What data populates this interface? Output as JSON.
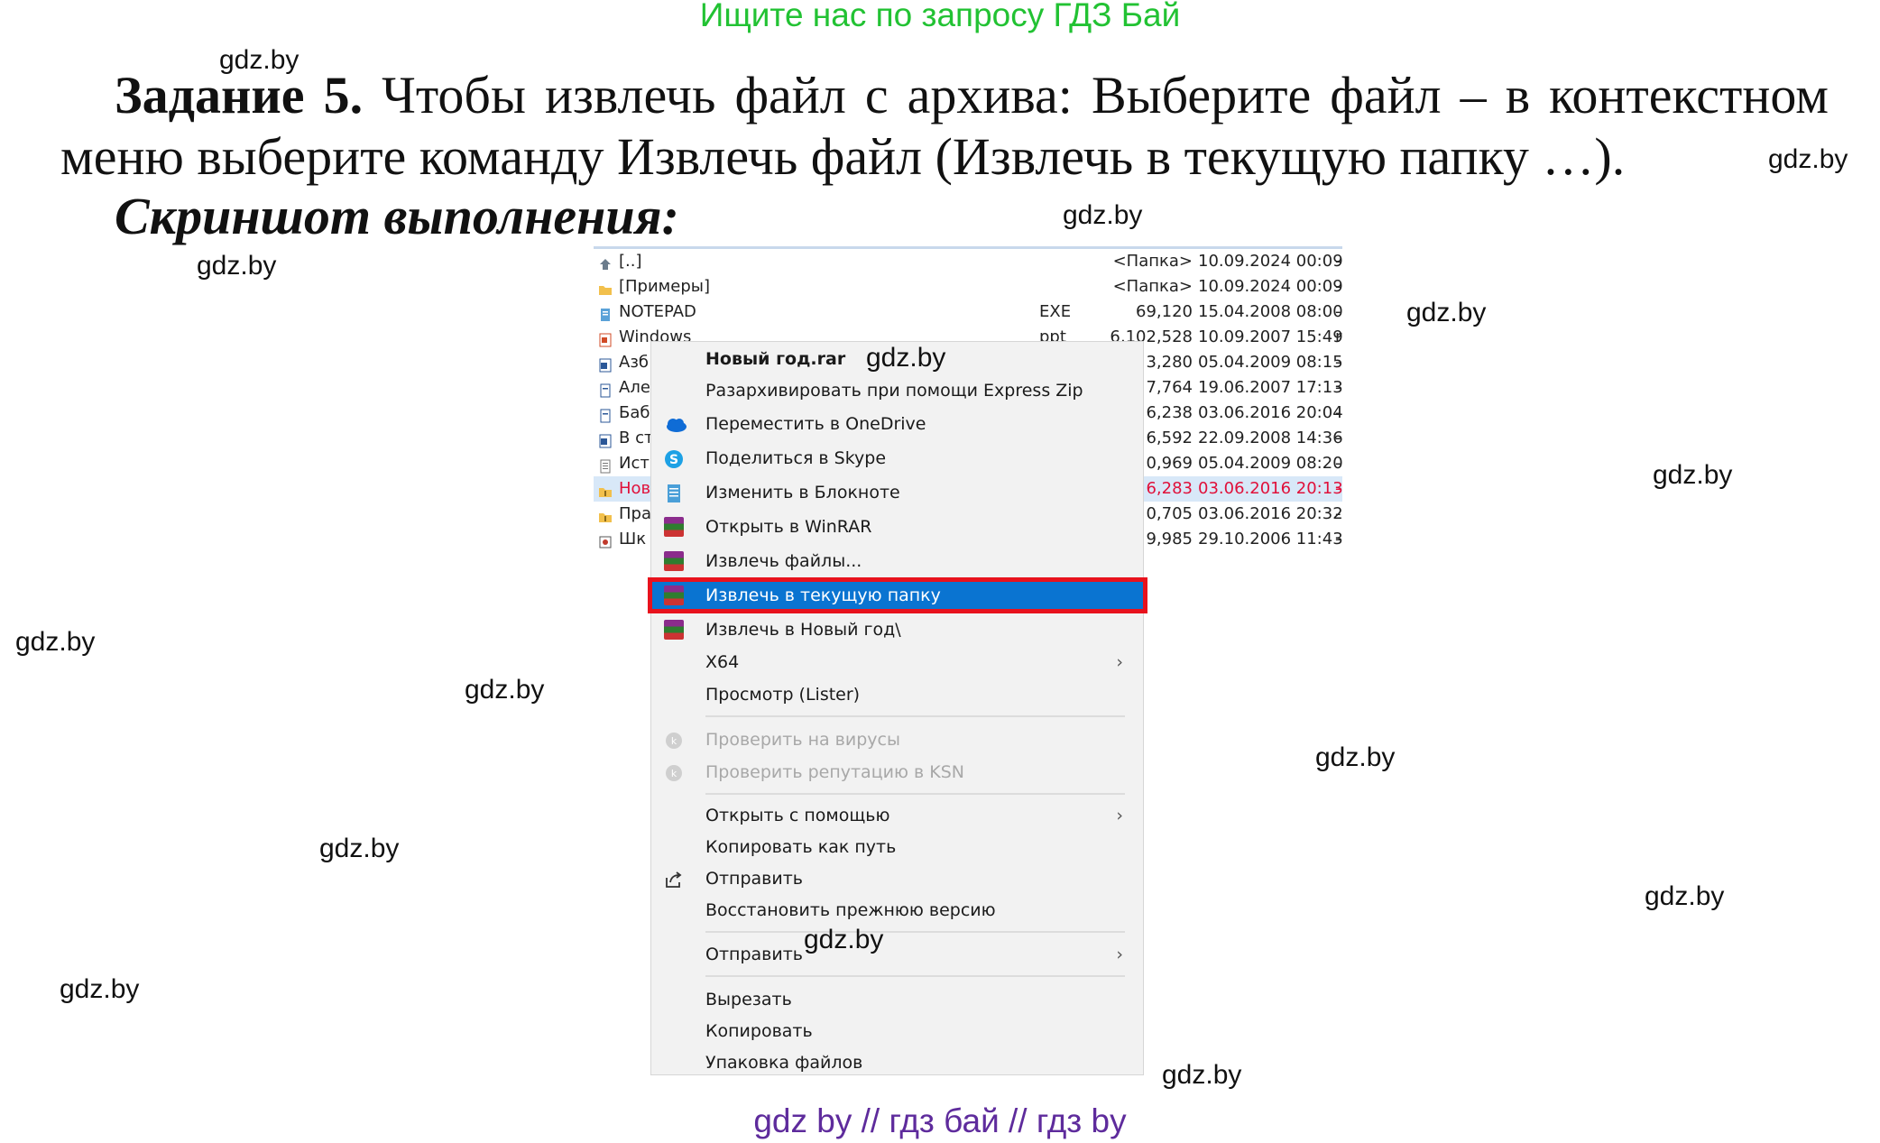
{
  "banner": "Ищите нас по запросу ГДЗ Бай",
  "task": {
    "title": "Задание 5.",
    "text1": "Чтобы извлечь файл с архива: Выберите файл – в контекстном",
    "text2": "меню выберите команду Извлечь файл (Извлечь в текущую папку …)."
  },
  "screenshot_caption": "Скриншот выполнения:",
  "watermark": "gdz.by",
  "file_list": [
    {
      "name": "[..]",
      "ext": "",
      "size": "<Папка>",
      "date": "10.09.2024 00:09",
      "attr": "-",
      "icon": "up-folder-icon"
    },
    {
      "name": "[Примеры]",
      "ext": "",
      "size": "<Папка>",
      "date": "10.09.2024 00:09",
      "attr": "-",
      "icon": "folder-icon"
    },
    {
      "name": "NOTEPAD",
      "ext": "EXE",
      "size": "69,120",
      "date": "15.04.2008 08:00",
      "attr": "-",
      "icon": "notepad-icon"
    },
    {
      "name": "Windows",
      "ext": "ppt",
      "size": "6,102,528",
      "date": "10.09.2007 15:49",
      "attr": "r",
      "icon": "ppt-icon"
    },
    {
      "name": "Азб",
      "ext": "",
      "size": "3,280",
      "date": "05.04.2009 08:15",
      "attr": "-",
      "icon": "word-icon"
    },
    {
      "name": "Але",
      "ext": "",
      "size": "7,764",
      "date": "19.06.2007 17:13",
      "attr": "-",
      "icon": "doc-icon"
    },
    {
      "name": "Баб",
      "ext": "",
      "size": "6,238",
      "date": "03.06.2016 20:04",
      "attr": "-",
      "icon": "doc-icon"
    },
    {
      "name": "В ст",
      "ext": "",
      "size": "6,592",
      "date": "22.09.2008 14:36",
      "attr": "-",
      "icon": "word-icon"
    },
    {
      "name": "Ист",
      "ext": "",
      "size": "0,969",
      "date": "05.04.2009 08:20",
      "attr": "-",
      "icon": "text-icon"
    },
    {
      "name": "Нов",
      "ext": "",
      "size": "6,283",
      "date": "03.06.2016 20:13",
      "attr": "-",
      "icon": "archive-icon",
      "selected": true
    },
    {
      "name": "Пра",
      "ext": "",
      "size": "0,705",
      "date": "03.06.2016 20:32",
      "attr": "-",
      "icon": "archive-icon"
    },
    {
      "name": "Шк",
      "ext": "",
      "size": "9,985",
      "date": "29.10.2006 11:43",
      "attr": "-",
      "icon": "media-icon"
    }
  ],
  "context_menu": {
    "header": "Новый год.rar",
    "items": [
      {
        "label": "Разархивировать при помощи Express Zip",
        "icon": ""
      },
      {
        "label": "Переместить в OneDrive",
        "icon": "onedrive-icon"
      },
      {
        "label": "Поделиться в Skype",
        "icon": "skype-icon"
      },
      {
        "label": "Изменить в Блокноте",
        "icon": "notepad-icon"
      },
      {
        "label": "Открыть в WinRAR",
        "icon": "winrar-icon"
      },
      {
        "label": "Извлечь файлы...",
        "icon": "winrar-icon"
      },
      {
        "label": "Извлечь в текущую папку",
        "icon": "winrar-icon",
        "highlighted": true
      },
      {
        "label": "Извлечь в Новый год\\",
        "icon": "winrar-icon"
      },
      {
        "label": "X64",
        "icon": "",
        "submenu": true
      },
      {
        "label": "Просмотр (Lister)",
        "icon": ""
      },
      {
        "label": "Проверить на вирусы",
        "icon": "kaspersky-icon",
        "disabled": true
      },
      {
        "label": "Проверить репутацию в KSN",
        "icon": "kaspersky-icon",
        "disabled": true
      },
      {
        "label": "Открыть с помощью",
        "icon": "",
        "submenu": true
      },
      {
        "label": "Копировать как путь",
        "icon": ""
      },
      {
        "label": "Отправить",
        "icon": "share-icon"
      },
      {
        "label": "Восстановить прежнюю версию",
        "icon": ""
      },
      {
        "label": "Отправить",
        "icon": "",
        "submenu": true
      },
      {
        "label": "Вырезать",
        "icon": ""
      },
      {
        "label": "Копировать",
        "icon": ""
      },
      {
        "label": "Упаковка файлов",
        "icon": ""
      }
    ],
    "submenu_arrow": "›"
  },
  "footer": "gdz by  //  гдз бай  //  гдз by",
  "colors": {
    "banner": "#22c233",
    "footer": "#5e2b9c",
    "highlight": "#0a74d1",
    "highlight_frame": "#e8121d"
  }
}
